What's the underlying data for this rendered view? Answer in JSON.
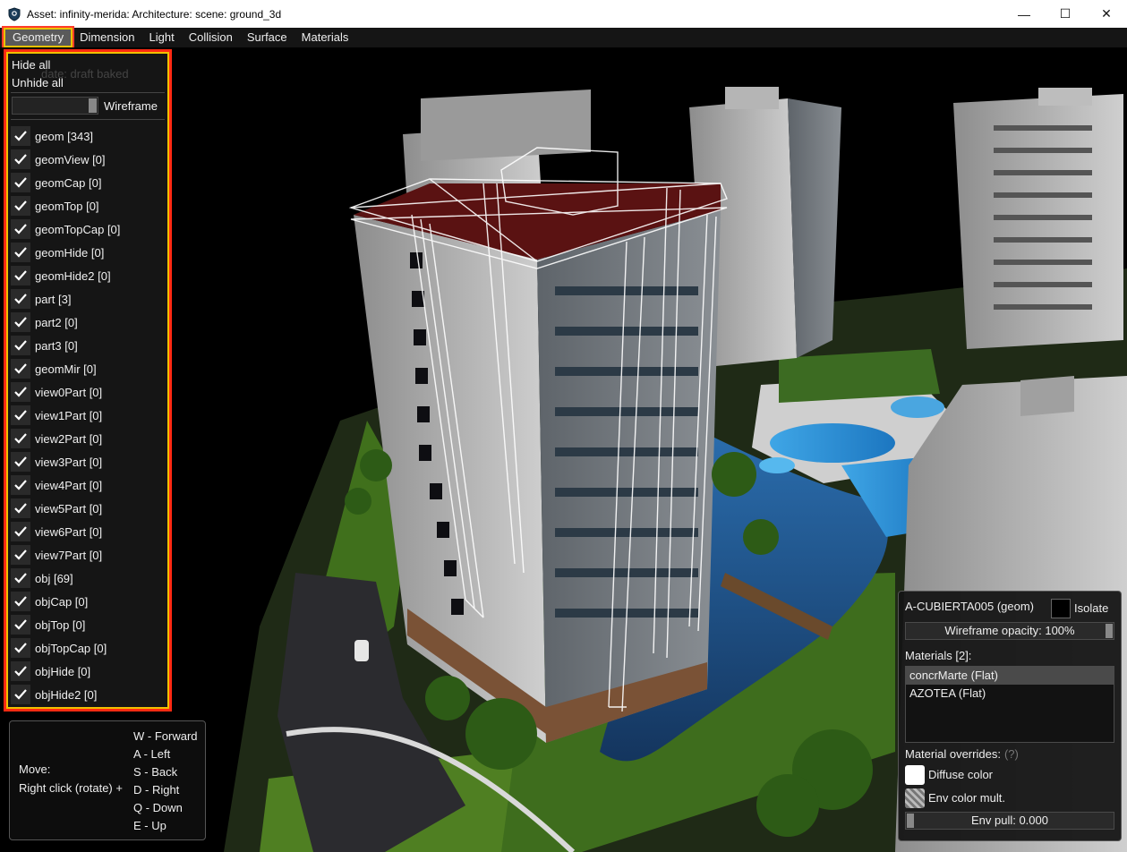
{
  "window": {
    "title": "Asset: infinity-merida: Architecture: scene: ground_3d",
    "minimize": "—",
    "maximize": "☐",
    "close": "✕"
  },
  "menu": [
    "Geometry",
    "Dimension",
    "Light",
    "Collision",
    "Surface",
    "Materials"
  ],
  "geometry_panel": {
    "hide_all": "Hide all",
    "unhide_all": "Unhide all",
    "ghost_text": "date: draft baked",
    "wireframe_label": "Wireframe",
    "layers": [
      "geom [343]",
      "geomView [0]",
      "geomCap [0]",
      "geomTop [0]",
      "geomTopCap [0]",
      "geomHide [0]",
      "geomHide2 [0]",
      "part [3]",
      "part2 [0]",
      "part3 [0]",
      "geomMir [0]",
      "view0Part [0]",
      "view1Part [0]",
      "view2Part [0]",
      "view3Part [0]",
      "view4Part [0]",
      "view5Part [0]",
      "view6Part [0]",
      "view7Part [0]",
      "obj [69]",
      "objCap [0]",
      "objTop [0]",
      "objTopCap [0]",
      "objHide [0]",
      "objHide2 [0]"
    ]
  },
  "help": {
    "move": "Move:",
    "right_click": "Right click (rotate) +",
    "keys": [
      "W - Forward",
      "A - Left",
      "S - Back",
      "D - Right",
      "Q - Down",
      "E - Up"
    ]
  },
  "asset_panel": {
    "object_name": "A-CUBIERTA005  (geom)",
    "isolate": "Isolate",
    "wireframe_opacity": "Wireframe opacity: 100%",
    "materials_title": "Materials [2]:",
    "materials": [
      "concrMarte (Flat)",
      "AZOTEA (Flat)"
    ],
    "overrides_title": "Material overrides:",
    "overrides_help": "(?)",
    "diffuse_color": "Diffuse color",
    "env_color_mult": "Env color mult.",
    "env_pull": "Env pull: 0.000"
  },
  "colors": {
    "menu_highlight": "#e8c200",
    "panel_outline": "#ff2a12"
  }
}
